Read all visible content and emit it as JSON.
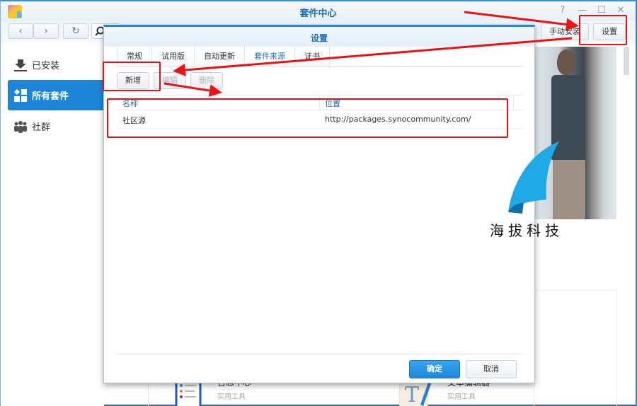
{
  "window": {
    "title": "套件中心",
    "controls": {
      "help": "?",
      "minimize": "—",
      "maximize": "☐",
      "close": "✕"
    }
  },
  "toolbar": {
    "back_icon": "‹",
    "forward_icon": "›",
    "refresh_icon": "↻",
    "manual_install_label": "手动安装",
    "settings_label": "设置"
  },
  "sidebar": {
    "items": [
      {
        "label": "已安装",
        "icon": "download-icon",
        "active": false
      },
      {
        "label": "所有套件",
        "icon": "grid-icon",
        "active": true
      },
      {
        "label": "社群",
        "icon": "community-icon",
        "active": false
      }
    ]
  },
  "background_packages": [
    {
      "name": "日志中心",
      "category": "实用工具",
      "icon": "log-center-icon"
    },
    {
      "name": "文本编辑器",
      "category": "实用工具",
      "icon": "text-editor-icon"
    }
  ],
  "dialog": {
    "title": "设置",
    "tabs": [
      {
        "label": "常规",
        "active": false
      },
      {
        "label": "试用版",
        "active": false
      },
      {
        "label": "自动更新",
        "active": false
      },
      {
        "label": "套件来源",
        "active": true
      },
      {
        "label": "证书",
        "active": false
      }
    ],
    "buttons": {
      "add": "新增",
      "edit": "编辑",
      "delete": "删除"
    },
    "grid": {
      "columns": [
        "名称",
        "位置"
      ],
      "rows": [
        {
          "name": "社区源",
          "location": "http://packages.synocommunity.com/"
        }
      ]
    },
    "footer": {
      "ok": "确定",
      "cancel": "取消"
    }
  },
  "annotations": {
    "watermark": "海拔科技",
    "highlight_color": "#ee1111",
    "accent_color": "#1c85d8"
  }
}
